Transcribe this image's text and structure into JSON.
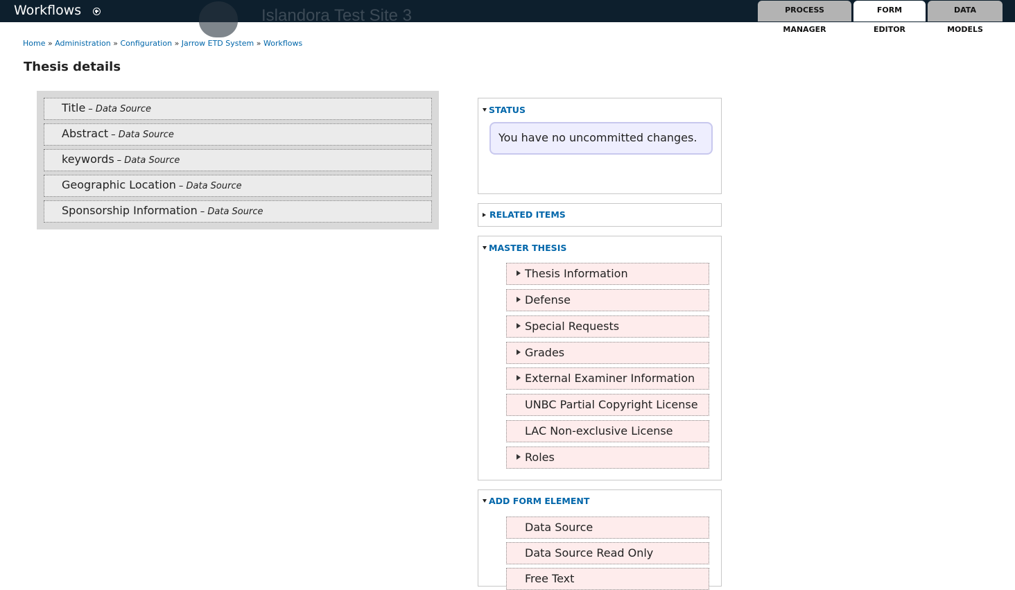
{
  "header": {
    "title": "Workflows",
    "watermark": "Islandora Test Site 3",
    "tabs": [
      {
        "label": "PROCESS MANAGER",
        "active": false
      },
      {
        "label": "FORM EDITOR",
        "active": true
      },
      {
        "label": "DATA MODELS",
        "active": false
      }
    ]
  },
  "breadcrumb": {
    "items": [
      "Home",
      "Administration",
      "Configuration",
      "Jarrow ETD System",
      "Workflows"
    ],
    "separator": "»"
  },
  "page": {
    "title": "Thesis details"
  },
  "form_fields": [
    {
      "label": "Title",
      "type": "– Data Source"
    },
    {
      "label": "Abstract",
      "type": "– Data Source"
    },
    {
      "label": "keywords",
      "type": "– Data Source"
    },
    {
      "label": "Geographic Location",
      "type": "– Data Source"
    },
    {
      "label": "Sponsorship Information",
      "type": "– Data Source"
    }
  ],
  "status": {
    "legend": "STATUS",
    "message": "You have no uncommitted changes."
  },
  "related_items": {
    "legend": "RELATED ITEMS"
  },
  "master_thesis": {
    "legend": "MASTER THESIS",
    "items": [
      {
        "label": "Thesis Information",
        "expandable": true
      },
      {
        "label": "Defense",
        "expandable": true
      },
      {
        "label": "Special Requests",
        "expandable": true
      },
      {
        "label": "Grades",
        "expandable": true
      },
      {
        "label": "External Examiner Information",
        "expandable": true
      },
      {
        "label": "UNBC Partial Copyright License",
        "expandable": false
      },
      {
        "label": "LAC Non-exclusive License",
        "expandable": false
      },
      {
        "label": "Roles",
        "expandable": true
      }
    ]
  },
  "add_form_element": {
    "legend": "ADD FORM ELEMENT",
    "items": [
      {
        "label": "Data Source"
      },
      {
        "label": "Data Source Read Only"
      },
      {
        "label": "Free Text"
      }
    ]
  },
  "colors": {
    "topbar": "#0d1f2d",
    "link": "#0066aa",
    "tab_inactive": "#b3b3b3",
    "item_bg": "#feecec",
    "field_bg": "#ebebeb",
    "status_bg": "#eeeefe"
  },
  "icons": {
    "header_add": "plus-circle-icon",
    "expanded": "triangle-down-icon",
    "collapsed": "triangle-right-icon"
  }
}
